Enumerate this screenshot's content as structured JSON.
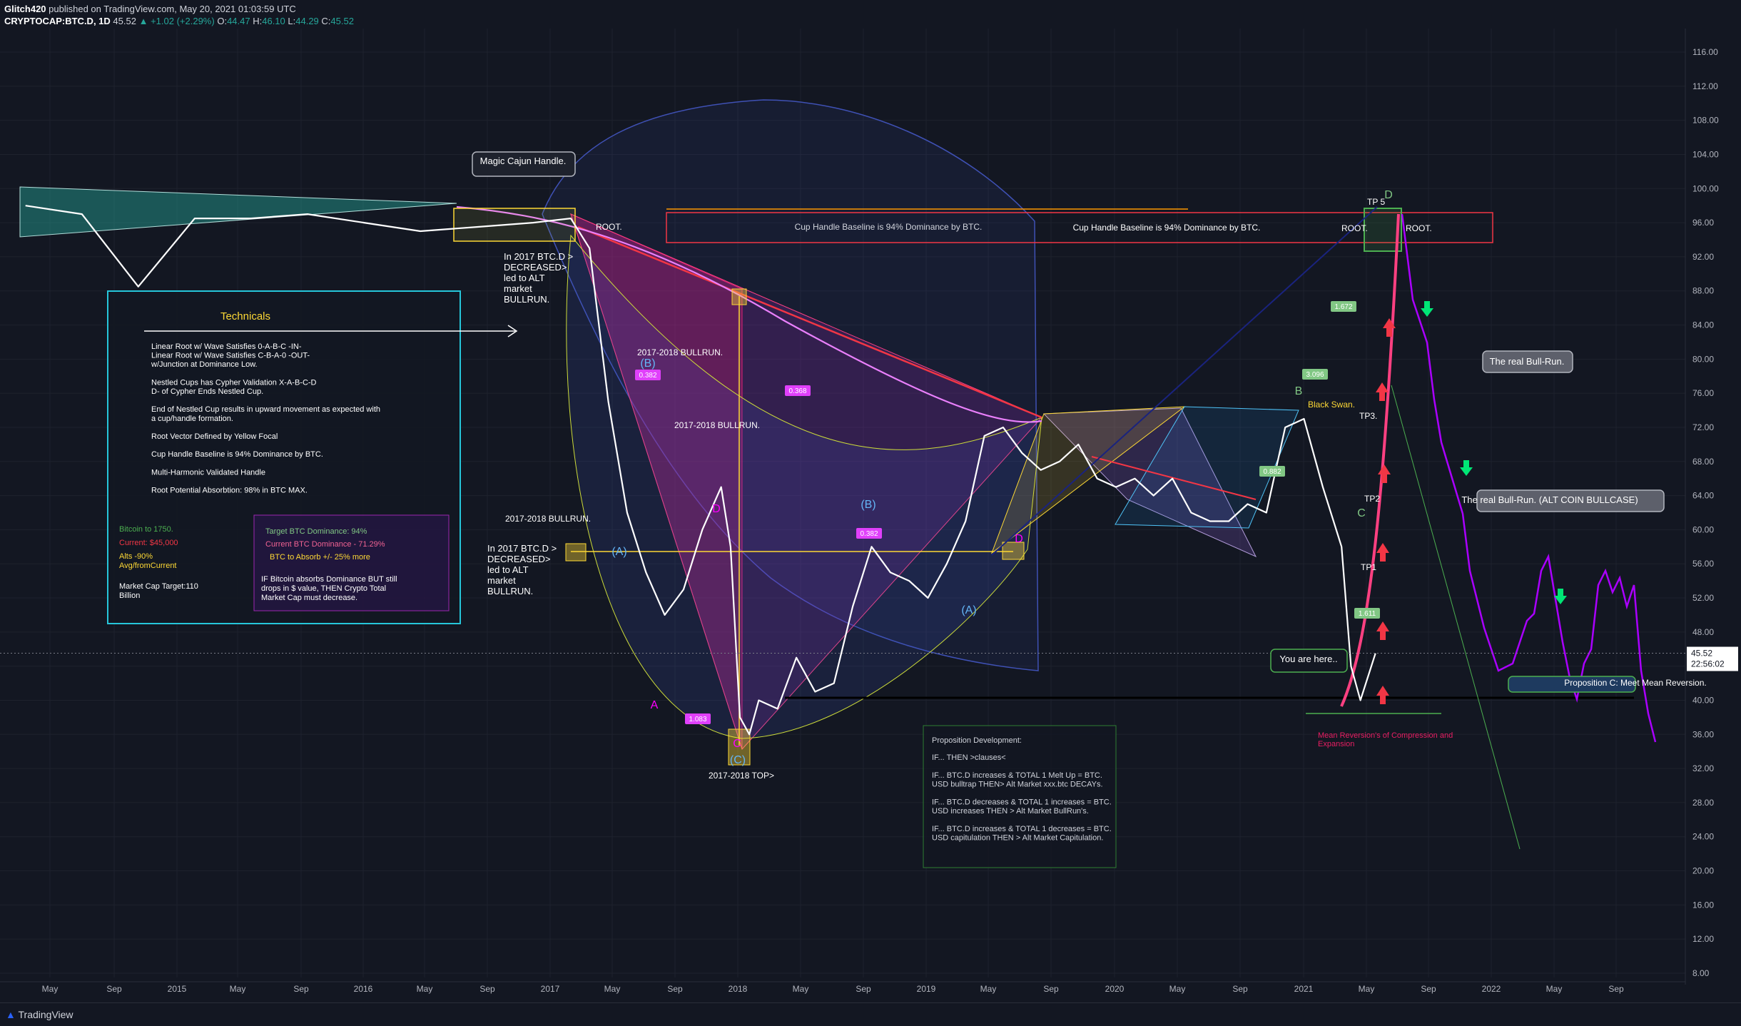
{
  "header": {
    "author": "Glitch420",
    "published": "published on TradingView.com, May 20, 2021 01:03:59 UTC",
    "symbol": "CRYPTOCAP:BTC.D, 1D",
    "last": "45.52",
    "change": "▲ +1.02 (+2.29%)",
    "o_label": "O:",
    "o": "44.47",
    "h_label": "H:",
    "h": "46.10",
    "l_label": "L:",
    "l": "44.29",
    "c_label": "C:",
    "c": "45.52"
  },
  "footer": {
    "brand": "TradingView"
  },
  "colors": {
    "bg": "#131722",
    "grid": "#1e222d",
    "price": "#ffffff",
    "magenta": "#ff00ff",
    "yellow": "#ffeb3b",
    "cyan": "#00bcd4",
    "red": "#f23645",
    "green": "#4caf50",
    "purple": "#9c27b0"
  },
  "chart_data": {
    "type": "line",
    "title": "",
    "ylim": [
      8,
      118
    ],
    "y_ticks": [
      "116.00",
      "112.00",
      "108.00",
      "104.00",
      "100.00",
      "96.00",
      "92.00",
      "88.00",
      "84.00",
      "80.00",
      "76.00",
      "72.00",
      "68.00",
      "64.00",
      "60.00",
      "56.00",
      "52.00",
      "48.00",
      "44.00",
      "40.00",
      "36.00",
      "32.00",
      "28.00",
      "24.00",
      "20.00",
      "16.00",
      "12.00",
      "8.00"
    ],
    "x_ticks": [
      "May",
      "Sep",
      "2015",
      "May",
      "Sep",
      "2016",
      "May",
      "Sep",
      "2017",
      "May",
      "Sep",
      "2018",
      "May",
      "Sep",
      "2019",
      "May",
      "Sep",
      "2020",
      "May",
      "Sep",
      "2021",
      "May",
      "Sep",
      "2022",
      "May",
      "Sep"
    ],
    "last_price_label": "45.52",
    "countdown_label": "22:56:02",
    "series": [
      {
        "x": [
          2014.2,
          2014.5,
          2014.8,
          2015.1,
          2015.4,
          2015.7,
          2016.0,
          2016.3,
          2016.6,
          2016.9,
          2017.1,
          2017.2,
          2017.3,
          2017.4,
          2017.5,
          2017.6,
          2017.7,
          2017.8,
          2017.9,
          2017.95,
          2018.0,
          2018.05,
          2018.1,
          2018.2,
          2018.3,
          2018.4,
          2018.5,
          2018.6,
          2018.7,
          2018.8,
          2018.9,
          2019.0,
          2019.1,
          2019.2,
          2019.3,
          2019.4,
          2019.5,
          2019.6,
          2019.7,
          2019.8,
          2019.9,
          2020.0,
          2020.1,
          2020.2,
          2020.3,
          2020.4,
          2020.5,
          2020.6,
          2020.7,
          2020.8,
          2020.9,
          2021.0,
          2021.1,
          2021.2,
          2021.25,
          2021.3,
          2021.38
        ],
        "y": [
          98,
          97,
          88.5,
          96.5,
          96.5,
          97,
          96,
          95,
          95.5,
          96,
          96.5,
          93,
          75,
          62,
          55,
          50,
          53,
          60,
          65,
          58,
          38,
          36,
          40,
          39,
          45,
          41,
          42,
          51,
          58,
          55,
          54,
          52,
          56,
          61,
          71,
          72,
          69,
          67,
          68,
          70,
          66,
          65,
          66,
          64,
          66,
          62,
          61,
          61,
          63,
          62,
          72,
          73,
          65,
          58,
          44,
          40,
          45.5
        ]
      }
    ],
    "annotations": [
      "Magic Cajun Handle.",
      "ROOT.",
      "Cup Handle Baseline is 94% Dominance by BTC.",
      "Cup Handle Baseline is 94% Dominance by BTC.",
      "ROOT.",
      "ROOT.",
      "In 2017 BTC.D > DECREASED> led to ALT market BULLRUN.",
      "In 2017 BTC.D > DECREASED> led to ALT market BULLRUN.",
      "2017-2018 BULLRUN.",
      "2017-2018 BULLRUN.",
      "2017-2018 BULLRUN.",
      "2017-2018 TOP>",
      "Black Swan.",
      "TP3.",
      "TP2",
      "TP1",
      "TP 5",
      "The real Bull-Run.",
      "The real Bull-Run. (ALT COIN BULLCASE)",
      "You are here..",
      "Proposition C: Meet Mean Reversion.",
      "Mean Reversion's of Compression and Expansion"
    ],
    "fib_labels": [
      "0.382",
      "0.368",
      "1.083",
      "0.382",
      "1.672",
      "3.096",
      "0.882",
      "1.611"
    ],
    "pattern_points": [
      "(B)",
      "(A)",
      "(C)",
      "(B)",
      "(A)",
      "A",
      "D",
      "C",
      "D",
      "B",
      "C",
      "D"
    ]
  },
  "technicals": {
    "title": "Technicals",
    "lines": [
      "Linear Root w/ Wave Satisfies 0-A-B-C -IN-",
      "Linear Root w/ Wave Satisfies C-B-A-0 -OUT-",
      "w/Junction at Dominance Low.",
      "",
      "Nestled Cups has Cypher Validation X-A-B-C-D",
      "D- of Cypher Ends Nestled Cup.",
      "",
      "End of Nestled Cup results in upward movement as expected with",
      "a cup/handle formation.",
      "",
      "Root Vector Defined by Yellow Focal",
      "",
      "Cup Handle Baseline is 94% Dominance by BTC.",
      "",
      "Multi-Harmonic Validated Handle",
      "",
      "Root Potential Absorbtion: 98% in BTC MAX."
    ],
    "left_col": [
      "Bitcoin to 1750.",
      "Current: $45,000",
      "Alts -90%",
      "Avg/fromCurrent",
      "Market Cap Target:110",
      "Billion"
    ],
    "right_col": [
      "Target BTC Dominance: 94%",
      "Current BTC Dominance - 71.29%",
      "BTC to Absorb +/- 25% more",
      "IF Bitcoin absorbs Dominance BUT still",
      "drops in $ value, THEN Crypto Total",
      "Market Cap must decrease."
    ]
  },
  "proposition": {
    "title": "Proposition Development:",
    "lines": [
      "IF... THEN >clauses<",
      "",
      "IF... BTC.D increases & TOTAL 1 Melt Up = BTC.",
      "USD bulltrap THEN> Alt Market xxx.btc DECAYs.",
      "",
      "IF... BTC.D decreases & TOTAL 1 increases = BTC.",
      "USD increases THEN > Alt Market  BullRun's.",
      "",
      "IF... BTC.D increases & TOTAL 1 decreases = BTC.",
      "USD capitulation THEN > Alt Market Capitulation."
    ]
  }
}
